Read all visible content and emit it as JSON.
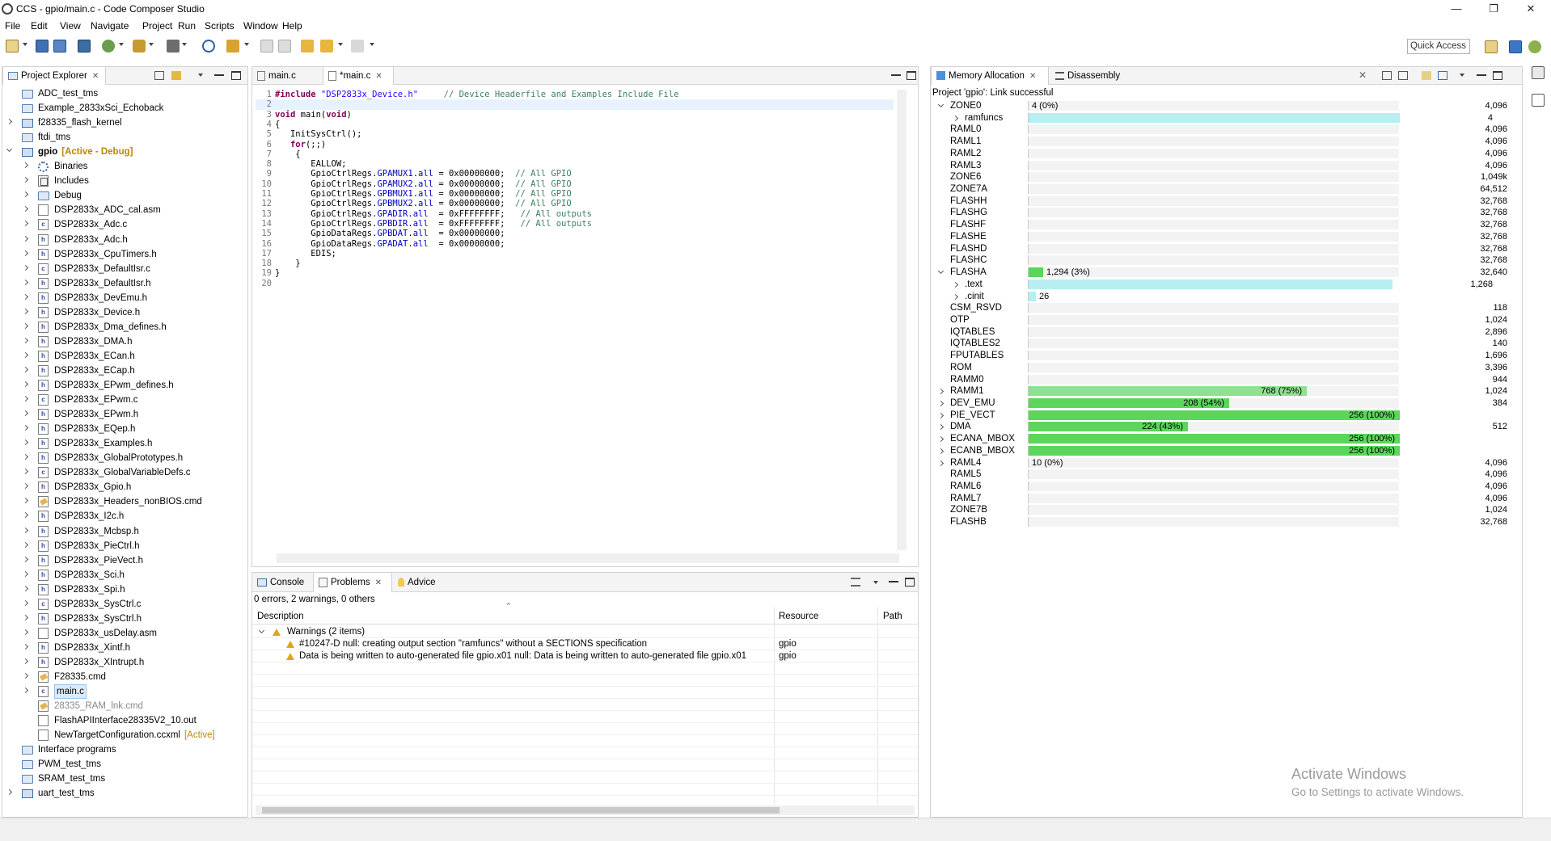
{
  "window": {
    "title": "CCS - gpio/main.c - Code Composer Studio",
    "minimize": "—",
    "restore": "❐",
    "close": "✕"
  },
  "menu": [
    "File",
    "Edit",
    "View",
    "Navigate",
    "Project",
    "Run",
    "Scripts",
    "Window",
    "Help"
  ],
  "toolbar": {
    "quick_access": "Quick Access"
  },
  "project_explorer": {
    "tab_label": "Project Explorer",
    "items": [
      {
        "label": "ADC_test_tms",
        "icon": "folder-icon",
        "indent": 0,
        "expander": "none"
      },
      {
        "label": "Example_2833xSci_Echoback",
        "icon": "folder-icon",
        "indent": 0,
        "expander": "none"
      },
      {
        "label": "f28335_flash_kernel",
        "icon": "proj-icon",
        "indent": 0,
        "expander": "closed"
      },
      {
        "label": "ftdi_tms",
        "icon": "folder-icon",
        "indent": 0,
        "expander": "none"
      },
      {
        "label": "gpio",
        "decor": "[Active - Debug]",
        "icon": "proj-icon",
        "indent": 0,
        "expander": "open",
        "bold": true
      },
      {
        "label": "Binaries",
        "icon": "gear-icon",
        "indent": 1,
        "expander": "closed"
      },
      {
        "label": "Includes",
        "icon": "lib-icon",
        "indent": 1,
        "expander": "closed"
      },
      {
        "label": "Debug",
        "icon": "folder-icon",
        "indent": 1,
        "expander": "closed"
      },
      {
        "label": "DSP2833x_ADC_cal.asm",
        "icon": "file-asm-icon",
        "indent": 1,
        "expander": "closed"
      },
      {
        "label": "DSP2833x_Adc.c",
        "icon": "file-c-icon",
        "indent": 1,
        "expander": "closed"
      },
      {
        "label": "DSP2833x_Adc.h",
        "icon": "file-h-icon",
        "indent": 1,
        "expander": "closed"
      },
      {
        "label": "DSP2833x_CpuTimers.h",
        "icon": "file-h-icon",
        "indent": 1,
        "expander": "closed"
      },
      {
        "label": "DSP2833x_DefaultIsr.c",
        "icon": "file-c-icon",
        "indent": 1,
        "expander": "closed"
      },
      {
        "label": "DSP2833x_DefaultIsr.h",
        "icon": "file-h-icon",
        "indent": 1,
        "expander": "closed"
      },
      {
        "label": "DSP2833x_DevEmu.h",
        "icon": "file-h-icon",
        "indent": 1,
        "expander": "closed"
      },
      {
        "label": "DSP2833x_Device.h",
        "icon": "file-h-icon",
        "indent": 1,
        "expander": "closed"
      },
      {
        "label": "DSP2833x_Dma_defines.h",
        "icon": "file-h-icon",
        "indent": 1,
        "expander": "closed"
      },
      {
        "label": "DSP2833x_DMA.h",
        "icon": "file-h-icon",
        "indent": 1,
        "expander": "closed"
      },
      {
        "label": "DSP2833x_ECan.h",
        "icon": "file-h-icon",
        "indent": 1,
        "expander": "closed"
      },
      {
        "label": "DSP2833x_ECap.h",
        "icon": "file-h-icon",
        "indent": 1,
        "expander": "closed"
      },
      {
        "label": "DSP2833x_EPwm_defines.h",
        "icon": "file-h-icon",
        "indent": 1,
        "expander": "closed"
      },
      {
        "label": "DSP2833x_EPwm.c",
        "icon": "file-c-icon",
        "indent": 1,
        "expander": "closed"
      },
      {
        "label": "DSP2833x_EPwm.h",
        "icon": "file-h-icon",
        "indent": 1,
        "expander": "closed"
      },
      {
        "label": "DSP2833x_EQep.h",
        "icon": "file-h-icon",
        "indent": 1,
        "expander": "closed"
      },
      {
        "label": "DSP2833x_Examples.h",
        "icon": "file-h-icon",
        "indent": 1,
        "expander": "closed"
      },
      {
        "label": "DSP2833x_GlobalPrototypes.h",
        "icon": "file-h-icon",
        "indent": 1,
        "expander": "closed"
      },
      {
        "label": "DSP2833x_GlobalVariableDefs.c",
        "icon": "file-c-icon",
        "indent": 1,
        "expander": "closed"
      },
      {
        "label": "DSP2833x_Gpio.h",
        "icon": "file-h-icon",
        "indent": 1,
        "expander": "closed"
      },
      {
        "label": "DSP2833x_Headers_nonBIOS.cmd",
        "icon": "file-cmd-icon",
        "indent": 1,
        "expander": "closed"
      },
      {
        "label": "DSP2833x_I2c.h",
        "icon": "file-h-icon",
        "indent": 1,
        "expander": "closed"
      },
      {
        "label": "DSP2833x_Mcbsp.h",
        "icon": "file-h-icon",
        "indent": 1,
        "expander": "closed"
      },
      {
        "label": "DSP2833x_PieCtrl.h",
        "icon": "file-h-icon",
        "indent": 1,
        "expander": "closed"
      },
      {
        "label": "DSP2833x_PieVect.h",
        "icon": "file-h-icon",
        "indent": 1,
        "expander": "closed"
      },
      {
        "label": "DSP2833x_Sci.h",
        "icon": "file-h-icon",
        "indent": 1,
        "expander": "closed"
      },
      {
        "label": "DSP2833x_Spi.h",
        "icon": "file-h-icon",
        "indent": 1,
        "expander": "closed"
      },
      {
        "label": "DSP2833x_SysCtrl.c",
        "icon": "file-c-icon",
        "indent": 1,
        "expander": "closed"
      },
      {
        "label": "DSP2833x_SysCtrl.h",
        "icon": "file-h-icon",
        "indent": 1,
        "expander": "closed"
      },
      {
        "label": "DSP2833x_usDelay.asm",
        "icon": "file-asm-icon",
        "indent": 1,
        "expander": "closed"
      },
      {
        "label": "DSP2833x_Xintf.h",
        "icon": "file-h-icon",
        "indent": 1,
        "expander": "closed"
      },
      {
        "label": "DSP2833x_XIntrupt.h",
        "icon": "file-h-icon",
        "indent": 1,
        "expander": "closed"
      },
      {
        "label": "F28335.cmd",
        "icon": "file-cmd-icon",
        "indent": 1,
        "expander": "closed"
      },
      {
        "label": "main.c",
        "icon": "file-c-icon",
        "indent": 1,
        "expander": "closed",
        "selected": true
      },
      {
        "label": "28335_RAM_lnk.cmd",
        "icon": "file-cmd-icon",
        "indent": 1,
        "expander": "none",
        "gray": true
      },
      {
        "label": "FlashAPIInterface28335V2_10.out",
        "icon": "file-asm-icon",
        "indent": 1,
        "expander": "none"
      },
      {
        "label": "NewTargetConfiguration.ccxml",
        "decor": "[Active]",
        "icon": "file-asm-icon",
        "indent": 1,
        "expander": "none"
      },
      {
        "label": "Interface programs",
        "icon": "folder-icon",
        "indent": 0,
        "expander": "none"
      },
      {
        "label": "PWM_test_tms",
        "icon": "folder-icon",
        "indent": 0,
        "expander": "none"
      },
      {
        "label": "SRAM_test_tms",
        "icon": "folder-icon",
        "indent": 0,
        "expander": "none"
      },
      {
        "label": "uart_test_tms",
        "icon": "proj-icon",
        "indent": 0,
        "expander": "closed"
      }
    ]
  },
  "editor": {
    "tabs": [
      {
        "label": "main.c",
        "active": false
      },
      {
        "label": "*main.c",
        "active": true
      }
    ],
    "lines": [
      [
        [
          "kw",
          "#include "
        ],
        [
          "str",
          "\"DSP2833x_Device.h\""
        ],
        [
          "",
          "     "
        ],
        [
          "cm",
          "// Device Headerfile and Examples Include File"
        ]
      ],
      [],
      [
        [
          "kw",
          "void"
        ],
        [
          "",
          " main("
        ],
        [
          "kw",
          "void"
        ],
        [
          "",
          ")"
        ]
      ],
      [
        [
          "",
          "{"
        ]
      ],
      [
        [
          "",
          "   InitSysCtrl();"
        ]
      ],
      [
        [
          "",
          "   "
        ],
        [
          "kw",
          "for"
        ],
        [
          "",
          "(;;)"
        ]
      ],
      [
        [
          "",
          "    {"
        ]
      ],
      [
        [
          "",
          "       EALLOW;"
        ]
      ],
      [
        [
          "",
          "       GpioCtrlRegs."
        ],
        [
          "fld",
          "GPAMUX1"
        ],
        [
          "",
          "."
        ],
        [
          "fld",
          "all"
        ],
        [
          "",
          " = 0x00000000;  "
        ],
        [
          "cm",
          "// All GPIO"
        ]
      ],
      [
        [
          "",
          "       GpioCtrlRegs."
        ],
        [
          "fld",
          "GPAMUX2"
        ],
        [
          "",
          "."
        ],
        [
          "fld",
          "all"
        ],
        [
          "",
          " = 0x00000000;  "
        ],
        [
          "cm",
          "// All GPIO"
        ]
      ],
      [
        [
          "",
          "       GpioCtrlRegs."
        ],
        [
          "fld",
          "GPBMUX1"
        ],
        [
          "",
          "."
        ],
        [
          "fld",
          "all"
        ],
        [
          "",
          " = 0x00000000;  "
        ],
        [
          "cm",
          "// All GPIO"
        ]
      ],
      [
        [
          "",
          "       GpioCtrlRegs."
        ],
        [
          "fld",
          "GPBMUX2"
        ],
        [
          "",
          "."
        ],
        [
          "fld",
          "all"
        ],
        [
          "",
          " = 0x00000000;  "
        ],
        [
          "cm",
          "// All GPIO"
        ]
      ],
      [
        [
          "",
          "       GpioCtrlRegs."
        ],
        [
          "fld",
          "GPADIR"
        ],
        [
          "",
          "."
        ],
        [
          "fld",
          "all"
        ],
        [
          "",
          "  = 0xFFFFFFFF;   "
        ],
        [
          "cm",
          "// All outputs"
        ]
      ],
      [
        [
          "",
          "       GpioCtrlRegs."
        ],
        [
          "fld",
          "GPBDIR"
        ],
        [
          "",
          "."
        ],
        [
          "fld",
          "all"
        ],
        [
          "",
          "  = 0xFFFFFFFF;   "
        ],
        [
          "cm",
          "// All outputs"
        ]
      ],
      [
        [
          "",
          "       GpioDataRegs."
        ],
        [
          "fld",
          "GPBDAT"
        ],
        [
          "",
          "."
        ],
        [
          "fld",
          "all"
        ],
        [
          "",
          "  = 0x00000000;"
        ]
      ],
      [
        [
          "",
          "       GpioDataRegs."
        ],
        [
          "fld",
          "GPADAT"
        ],
        [
          "",
          "."
        ],
        [
          "fld",
          "all"
        ],
        [
          "",
          "  = 0x00000000;"
        ]
      ],
      [
        [
          "",
          "       EDIS;"
        ]
      ],
      [
        [
          "",
          "    }"
        ]
      ],
      [
        [
          "",
          "}"
        ]
      ],
      []
    ]
  },
  "console_panel": {
    "tabs": [
      {
        "label": "Console",
        "active": false
      },
      {
        "label": "Problems",
        "active": true
      },
      {
        "label": "Advice",
        "active": false
      }
    ],
    "summary": "0 errors, 2 warnings, 0 others",
    "columns": [
      "Description",
      "Resource",
      "Path"
    ],
    "group_label": "Warnings (2 items)",
    "rows": [
      {
        "description": "#10247-D null: creating output section \"ramfuncs\" without a SECTIONS specification",
        "resource": "gpio",
        "path": ""
      },
      {
        "description": "Data is being written to auto-generated file gpio.x01 null: Data is being written to auto-generated file gpio.x01",
        "resource": "gpio",
        "path": ""
      }
    ]
  },
  "memory_allocation": {
    "tabs": [
      {
        "label": "Memory Allocation",
        "active": true
      },
      {
        "label": "Disassembly",
        "active": false
      }
    ],
    "status": "Project 'gpio': Link successful",
    "colors": {
      "fill_green": "#5bd65b",
      "fill_green_light": "#8fe08f",
      "fill_cyan": "#b6eef2"
    },
    "rows": [
      {
        "name": "ZONE0",
        "expander": "open",
        "used": "4 (0%)",
        "total": "4,096",
        "fill": 0,
        "color": "none"
      },
      {
        "name": "ramfuncs",
        "expander": "closed",
        "child": true,
        "used": "",
        "total": "4",
        "fill": 1.0,
        "color": "cyan"
      },
      {
        "name": "RAML0",
        "total": "4,096",
        "fill": 0
      },
      {
        "name": "RAML1",
        "total": "4,096",
        "fill": 0
      },
      {
        "name": "RAML2",
        "total": "4,096",
        "fill": 0
      },
      {
        "name": "RAML3",
        "total": "4,096",
        "fill": 0
      },
      {
        "name": "ZONE6",
        "total": "1,049k",
        "fill": 0
      },
      {
        "name": "ZONE7A",
        "total": "64,512",
        "fill": 0
      },
      {
        "name": "FLASHH",
        "total": "32,768",
        "fill": 0
      },
      {
        "name": "FLASHG",
        "total": "32,768",
        "fill": 0
      },
      {
        "name": "FLASHF",
        "total": "32,768",
        "fill": 0
      },
      {
        "name": "FLASHE",
        "total": "32,768",
        "fill": 0
      },
      {
        "name": "FLASHD",
        "total": "32,768",
        "fill": 0
      },
      {
        "name": "FLASHC",
        "total": "32,768",
        "fill": 0
      },
      {
        "name": "FLASHA",
        "expander": "open",
        "used": "1,294 (3%)",
        "total": "32,640",
        "fill": 0.04,
        "color": "green"
      },
      {
        "name": ".text",
        "expander": "closed",
        "child": true,
        "used": "",
        "total": "1,268",
        "fill": 0.98,
        "color": "cyan"
      },
      {
        "name": ".cinit",
        "expander": "closed",
        "child": true,
        "used": "26",
        "total": "",
        "fill": 0.02,
        "color": "cyan"
      },
      {
        "name": "CSM_RSVD",
        "total": "118",
        "fill": 0
      },
      {
        "name": "OTP",
        "total": "1,024",
        "fill": 0
      },
      {
        "name": "IQTABLES",
        "total": "2,896",
        "fill": 0
      },
      {
        "name": "IQTABLES2",
        "total": "140",
        "fill": 0
      },
      {
        "name": "FPUTABLES",
        "total": "1,696",
        "fill": 0
      },
      {
        "name": "ROM",
        "total": "3,396",
        "fill": 0
      },
      {
        "name": "RAMM0",
        "total": "944",
        "fill": 0
      },
      {
        "name": "RAMM1",
        "expander": "closed",
        "used": "768 (75%)",
        "total": "1,024",
        "fill": 0.75,
        "color": "green_light"
      },
      {
        "name": "DEV_EMU",
        "expander": "closed",
        "used": "208 (54%)",
        "total": "384",
        "fill": 0.54,
        "color": "green"
      },
      {
        "name": "PIE_VECT",
        "expander": "closed",
        "used": "256 (100%)",
        "total": "",
        "fill": 1.0,
        "color": "green"
      },
      {
        "name": "DMA",
        "expander": "closed",
        "used": "224 (43%)",
        "total": "512",
        "fill": 0.43,
        "color": "green"
      },
      {
        "name": "ECANA_MBOX",
        "expander": "closed",
        "used": "256 (100%)",
        "total": "",
        "fill": 1.0,
        "color": "green"
      },
      {
        "name": "ECANB_MBOX",
        "expander": "closed",
        "used": "256 (100%)",
        "total": "",
        "fill": 1.0,
        "color": "green"
      },
      {
        "name": "RAML4",
        "expander": "closed",
        "used": "10 (0%)",
        "total": "4,096",
        "fill": 0,
        "color": "none"
      },
      {
        "name": "RAML5",
        "total": "4,096",
        "fill": 0
      },
      {
        "name": "RAML6",
        "total": "4,096",
        "fill": 0
      },
      {
        "name": "RAML7",
        "total": "4,096",
        "fill": 0
      },
      {
        "name": "ZONE7B",
        "total": "1,024",
        "fill": 0
      },
      {
        "name": "FLASHB",
        "total": "32,768",
        "fill": 0
      }
    ]
  },
  "watermark": {
    "line1": "Activate Windows",
    "line2": "Go to Settings to activate Windows."
  }
}
